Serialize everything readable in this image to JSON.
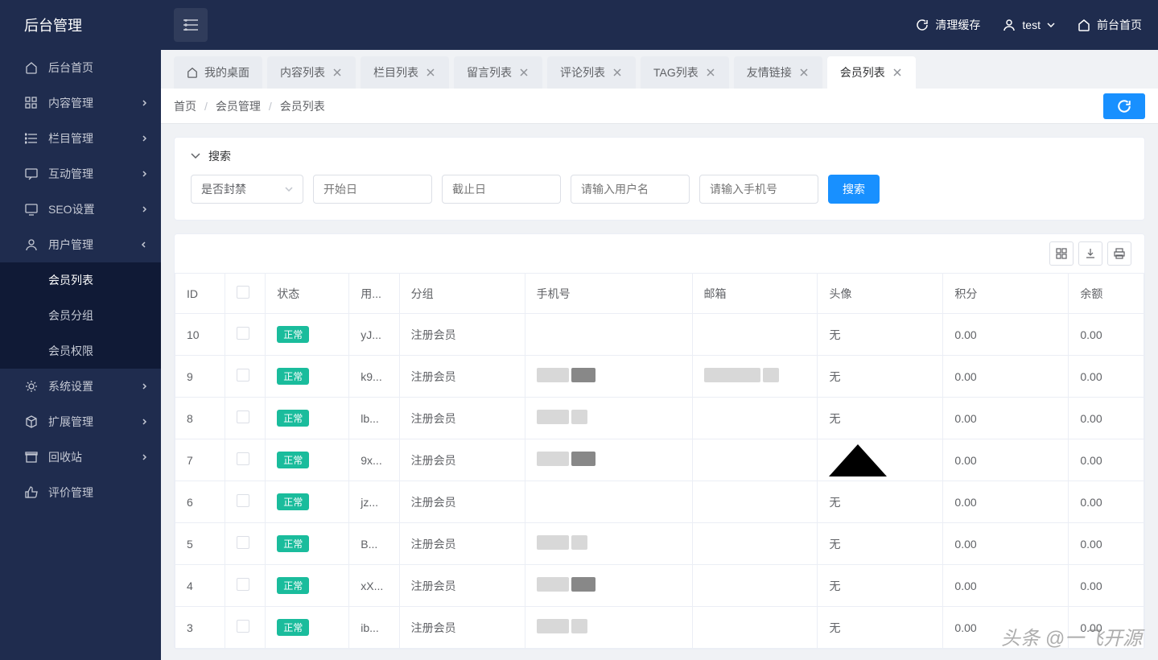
{
  "app_title": "后台管理",
  "header": {
    "clear_cache": "清理缓存",
    "user": "test",
    "frontend": "前台首页"
  },
  "sidebar": {
    "items": [
      {
        "label": "后台首页",
        "icon": "home",
        "has_children": false
      },
      {
        "label": "内容管理",
        "icon": "grid",
        "has_children": true
      },
      {
        "label": "栏目管理",
        "icon": "list",
        "has_children": true
      },
      {
        "label": "互动管理",
        "icon": "chat",
        "has_children": true
      },
      {
        "label": "SEO设置",
        "icon": "screen",
        "has_children": true
      },
      {
        "label": "用户管理",
        "icon": "user",
        "has_children": true,
        "expanded": true,
        "children": [
          {
            "label": "会员列表",
            "active": true
          },
          {
            "label": "会员分组"
          },
          {
            "label": "会员权限"
          }
        ]
      },
      {
        "label": "系统设置",
        "icon": "gear",
        "has_children": true
      },
      {
        "label": "扩展管理",
        "icon": "package",
        "has_children": true
      },
      {
        "label": "回收站",
        "icon": "archive",
        "has_children": true
      },
      {
        "label": "评价管理",
        "icon": "thumb",
        "has_children": false
      }
    ]
  },
  "tabs": [
    {
      "label": "我的桌面",
      "closable": false,
      "has_icon": true
    },
    {
      "label": "内容列表",
      "closable": true
    },
    {
      "label": "栏目列表",
      "closable": true
    },
    {
      "label": "留言列表",
      "closable": true
    },
    {
      "label": "评论列表",
      "closable": true
    },
    {
      "label": "TAG列表",
      "closable": true
    },
    {
      "label": "友情链接",
      "closable": true
    },
    {
      "label": "会员列表",
      "closable": true,
      "active": true
    }
  ],
  "breadcrumb": [
    "首页",
    "会员管理",
    "会员列表"
  ],
  "search": {
    "title": "搜索",
    "ban_select": "是否封禁",
    "start_date": "开始日",
    "end_date": "截止日",
    "username_ph": "请输入用户名",
    "phone_ph": "请输入手机号",
    "btn": "搜索"
  },
  "table": {
    "headers": {
      "id": "ID",
      "status": "状态",
      "username": "用...",
      "group": "分组",
      "phone": "手机号",
      "email": "邮箱",
      "avatar": "头像",
      "points": "积分",
      "balance": "余额"
    },
    "status_normal": "正常",
    "rows": [
      {
        "id": "10",
        "user": "yJ...",
        "group": "注册会员",
        "avatar": "无",
        "points": "0.00",
        "balance": "0.00"
      },
      {
        "id": "9",
        "user": "k9...",
        "group": "注册会员",
        "avatar": "无",
        "points": "0.00",
        "balance": "0.00",
        "phone_blur": true,
        "email_blur": true
      },
      {
        "id": "8",
        "user": "lb...",
        "group": "注册会员",
        "avatar": "无",
        "points": "0.00",
        "balance": "0.00",
        "phone_blur_light": true
      },
      {
        "id": "7",
        "user": "9x...",
        "group": "注册会员",
        "avatar": "triangle",
        "points": "0.00",
        "balance": "0.00",
        "phone_blur": true
      },
      {
        "id": "6",
        "user": "jz...",
        "group": "注册会员",
        "avatar": "无",
        "points": "0.00",
        "balance": "0.00"
      },
      {
        "id": "5",
        "user": "B...",
        "group": "注册会员",
        "avatar": "无",
        "points": "0.00",
        "balance": "0.00",
        "phone_blur_light": true
      },
      {
        "id": "4",
        "user": "xX...",
        "group": "注册会员",
        "avatar": "无",
        "points": "0.00",
        "balance": "0.00",
        "phone_blur": true
      },
      {
        "id": "3",
        "user": "ib...",
        "group": "注册会员",
        "avatar": "无",
        "points": "0.00",
        "balance": "0.00",
        "phone_blur_light": true
      }
    ]
  },
  "watermark": "头条 @一飞开源"
}
